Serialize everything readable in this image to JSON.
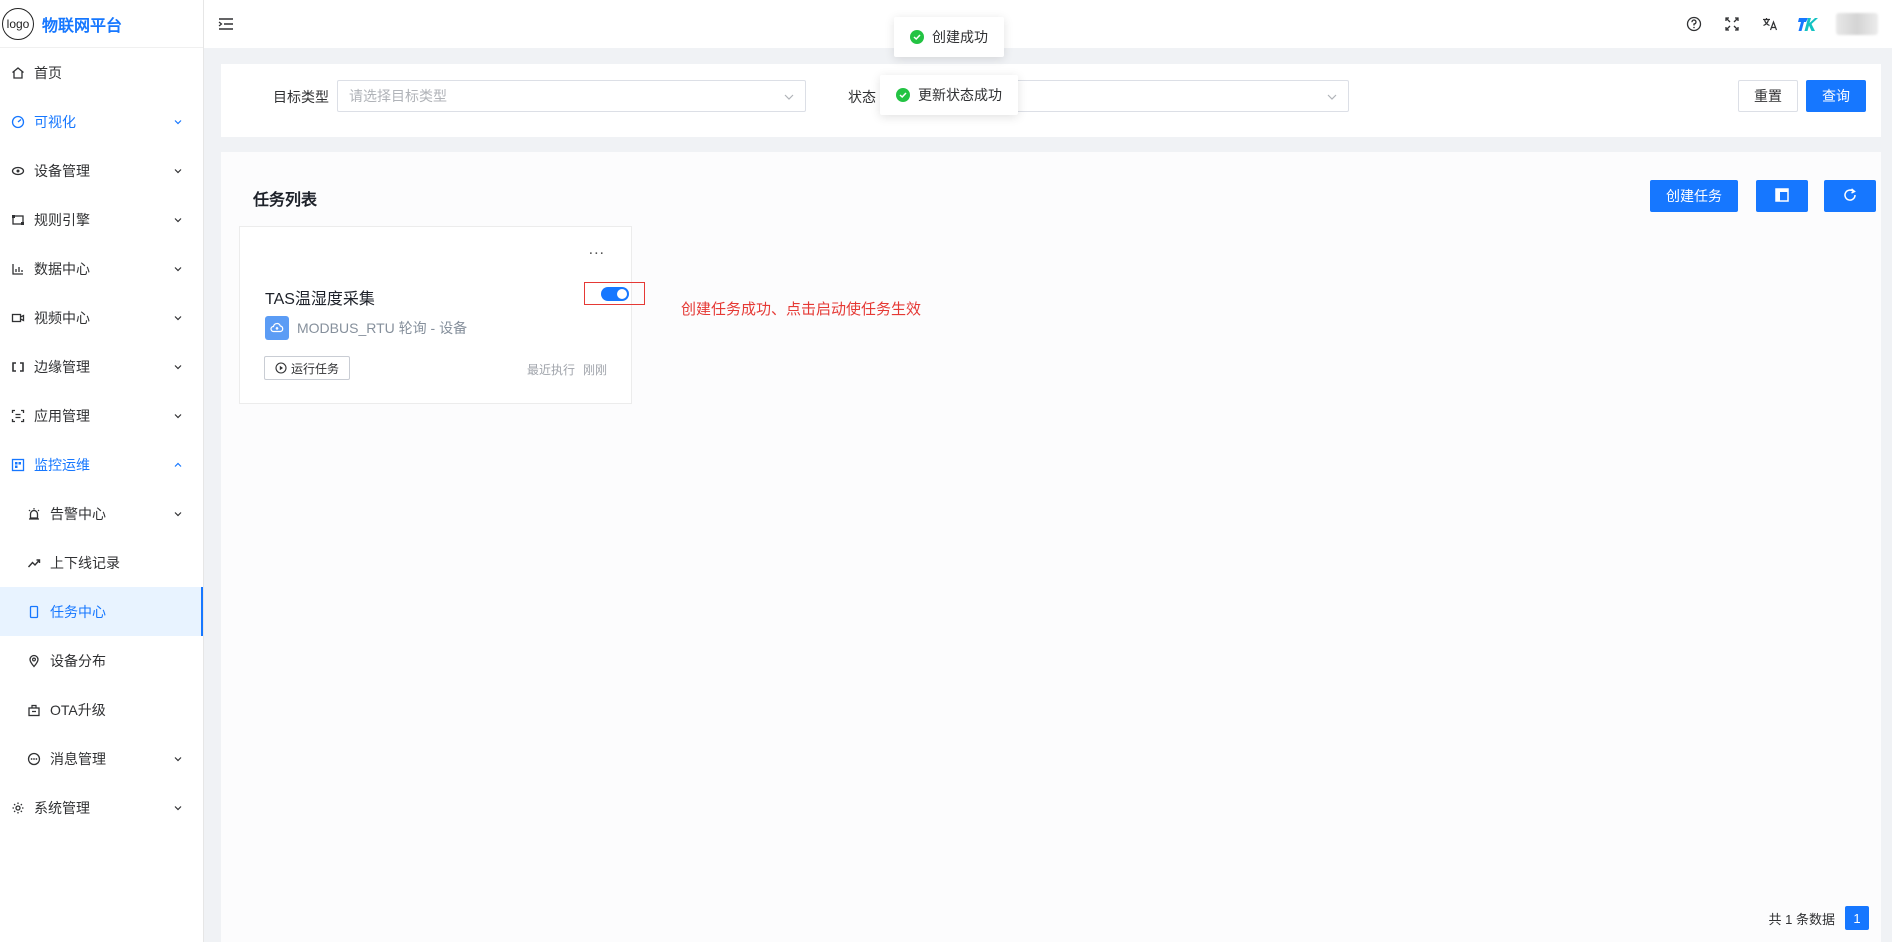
{
  "brand": {
    "logo_text": "logo",
    "title": "物联网平台"
  },
  "sidebar": {
    "items": [
      {
        "label": "首页"
      },
      {
        "label": "可视化"
      },
      {
        "label": "设备管理"
      },
      {
        "label": "规则引擎"
      },
      {
        "label": "数据中心"
      },
      {
        "label": "视频中心"
      },
      {
        "label": "边缘管理"
      },
      {
        "label": "应用管理"
      },
      {
        "label": "监控运维"
      },
      {
        "label": "告警中心"
      },
      {
        "label": "上下线记录"
      },
      {
        "label": "任务中心"
      },
      {
        "label": "设备分布"
      },
      {
        "label": "OTA升级"
      },
      {
        "label": "消息管理"
      },
      {
        "label": "系统管理"
      }
    ]
  },
  "filter": {
    "target_type_label": "目标类型",
    "target_type_placeholder": "请选择目标类型",
    "status_label": "状态",
    "reset_label": "重置",
    "query_label": "查询"
  },
  "panel": {
    "title": "任务列表",
    "create_label": "创建任务"
  },
  "card": {
    "more": "...",
    "name": "TAS温湿度采集",
    "type_text": "MODBUS_RTU 轮询 - 设备",
    "run_label": "运行任务",
    "last_run_label": "最近执行",
    "last_run_value": "刚刚",
    "enabled": true
  },
  "annotation": "创建任务成功、点击启动使任务生效",
  "pager": {
    "total_text": "共 1 条数据",
    "current_page": "1"
  },
  "toasts": [
    {
      "text": "创建成功"
    },
    {
      "text": "更新状态成功"
    }
  ],
  "colors": {
    "primary": "#1677ff",
    "success": "#23c343",
    "annotation": "#e53935"
  }
}
